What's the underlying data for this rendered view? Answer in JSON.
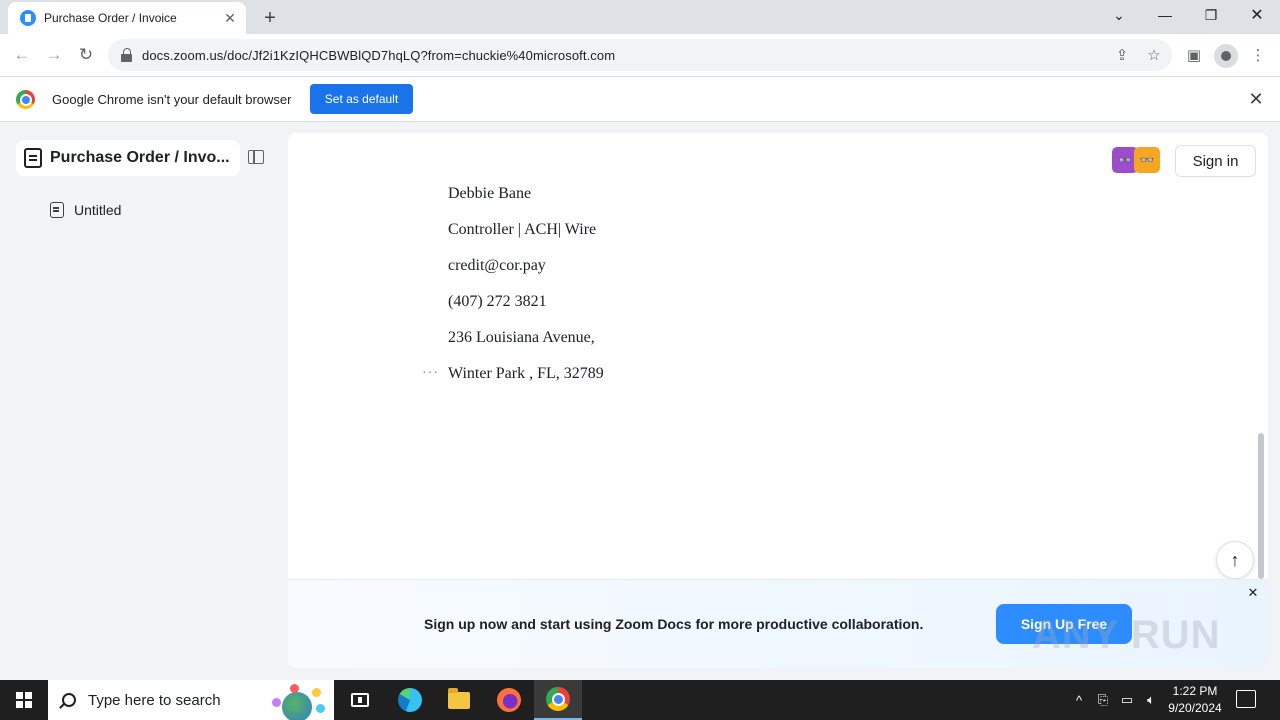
{
  "browser": {
    "tab_title": "Purchase Order / Invoice",
    "url": "docs.zoom.us/doc/Jf2i1KzIQHCBWBlQD7hqLQ?from=chuckie%40microsoft.com"
  },
  "infobar": {
    "message": "Google Chrome isn't your default browser",
    "set_default_label": "Set as default"
  },
  "sidebar": {
    "doc_title": "Purchase Order / Invo...",
    "items": [
      {
        "label": "Untitled"
      }
    ]
  },
  "header": {
    "sign_in_label": "Sign in"
  },
  "document": {
    "lines": [
      "Debbie Bane",
      "Controller | ACH| Wire",
      "credit@cor.pay",
      "(407) 272 3821",
      "236 Louisiana Avenue,",
      "Winter Park , FL, 32789"
    ],
    "ellipsis": "···"
  },
  "promo": {
    "text": "Sign up now and start using Zoom Docs for more productive collaboration.",
    "cta_label": "Sign Up Free",
    "watermark": "ANY RUN"
  },
  "taskbar": {
    "search_placeholder": "Type here to search",
    "time": "1:22 PM",
    "date": "9/20/2024"
  },
  "colors": {
    "primary": "#2d8cff",
    "chrome_blue": "#1a73e8",
    "taskbar": "#1f1f1f"
  }
}
